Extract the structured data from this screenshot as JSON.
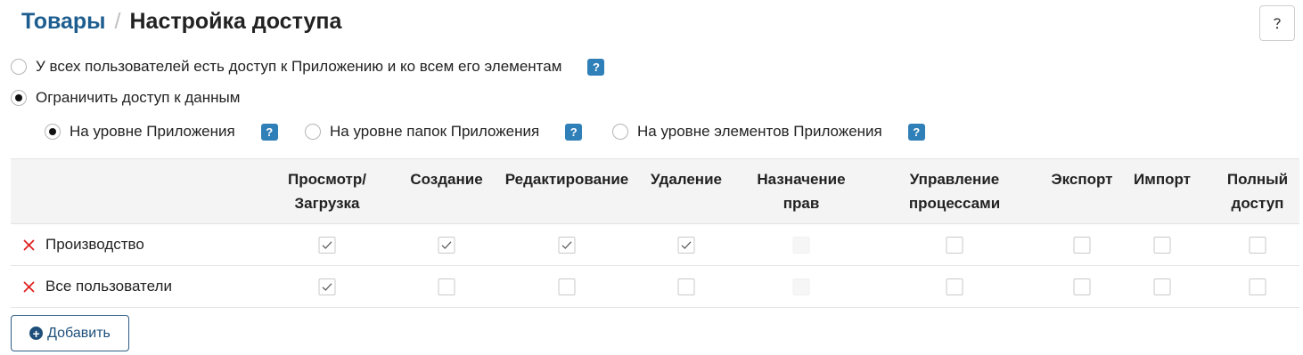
{
  "breadcrumb": {
    "parent": "Товары",
    "separator": "/",
    "current": "Настройка доступа"
  },
  "help_button": {
    "icon": "question-icon",
    "glyph": "?"
  },
  "access_options": [
    {
      "label": "У всех пользователей есть доступ к Приложению и ко всем его элементам",
      "checked": false,
      "help": "?"
    },
    {
      "label": "Ограничить доступ к данным",
      "checked": true
    }
  ],
  "level_options": [
    {
      "label": "На уровне Приложения",
      "checked": true,
      "help": "?"
    },
    {
      "label": "На уровне папок Приложения",
      "checked": false,
      "help": "?"
    },
    {
      "label": "На уровне элементов Приложения",
      "checked": false,
      "help": "?"
    }
  ],
  "table": {
    "columns": [
      [
        "Просмотр/",
        "Загрузка"
      ],
      [
        "Создание"
      ],
      [
        "Редактирование"
      ],
      [
        "Удаление"
      ],
      [
        "Назначение",
        "прав"
      ],
      [
        "Управление",
        "процессами"
      ],
      [
        "Экспорт"
      ],
      [
        "Импорт"
      ],
      [
        "Полный",
        "доступ"
      ]
    ],
    "rows": [
      {
        "label": "Производство",
        "values": [
          true,
          true,
          true,
          true,
          false,
          false,
          false,
          false,
          false
        ],
        "disabled": [
          false,
          false,
          false,
          false,
          true,
          false,
          false,
          false,
          false
        ]
      },
      {
        "label": "Все пользователи",
        "values": [
          true,
          false,
          false,
          false,
          false,
          false,
          false,
          false,
          false
        ],
        "disabled": [
          false,
          false,
          false,
          false,
          true,
          false,
          false,
          false,
          false
        ]
      }
    ]
  },
  "add_button": {
    "label": "Добавить",
    "icon": "plus-circle-icon"
  },
  "colors": {
    "link": "#1d5d8f",
    "badge": "#2f7fb8",
    "remove": "#e02020",
    "button_border": "#2f5d86"
  }
}
